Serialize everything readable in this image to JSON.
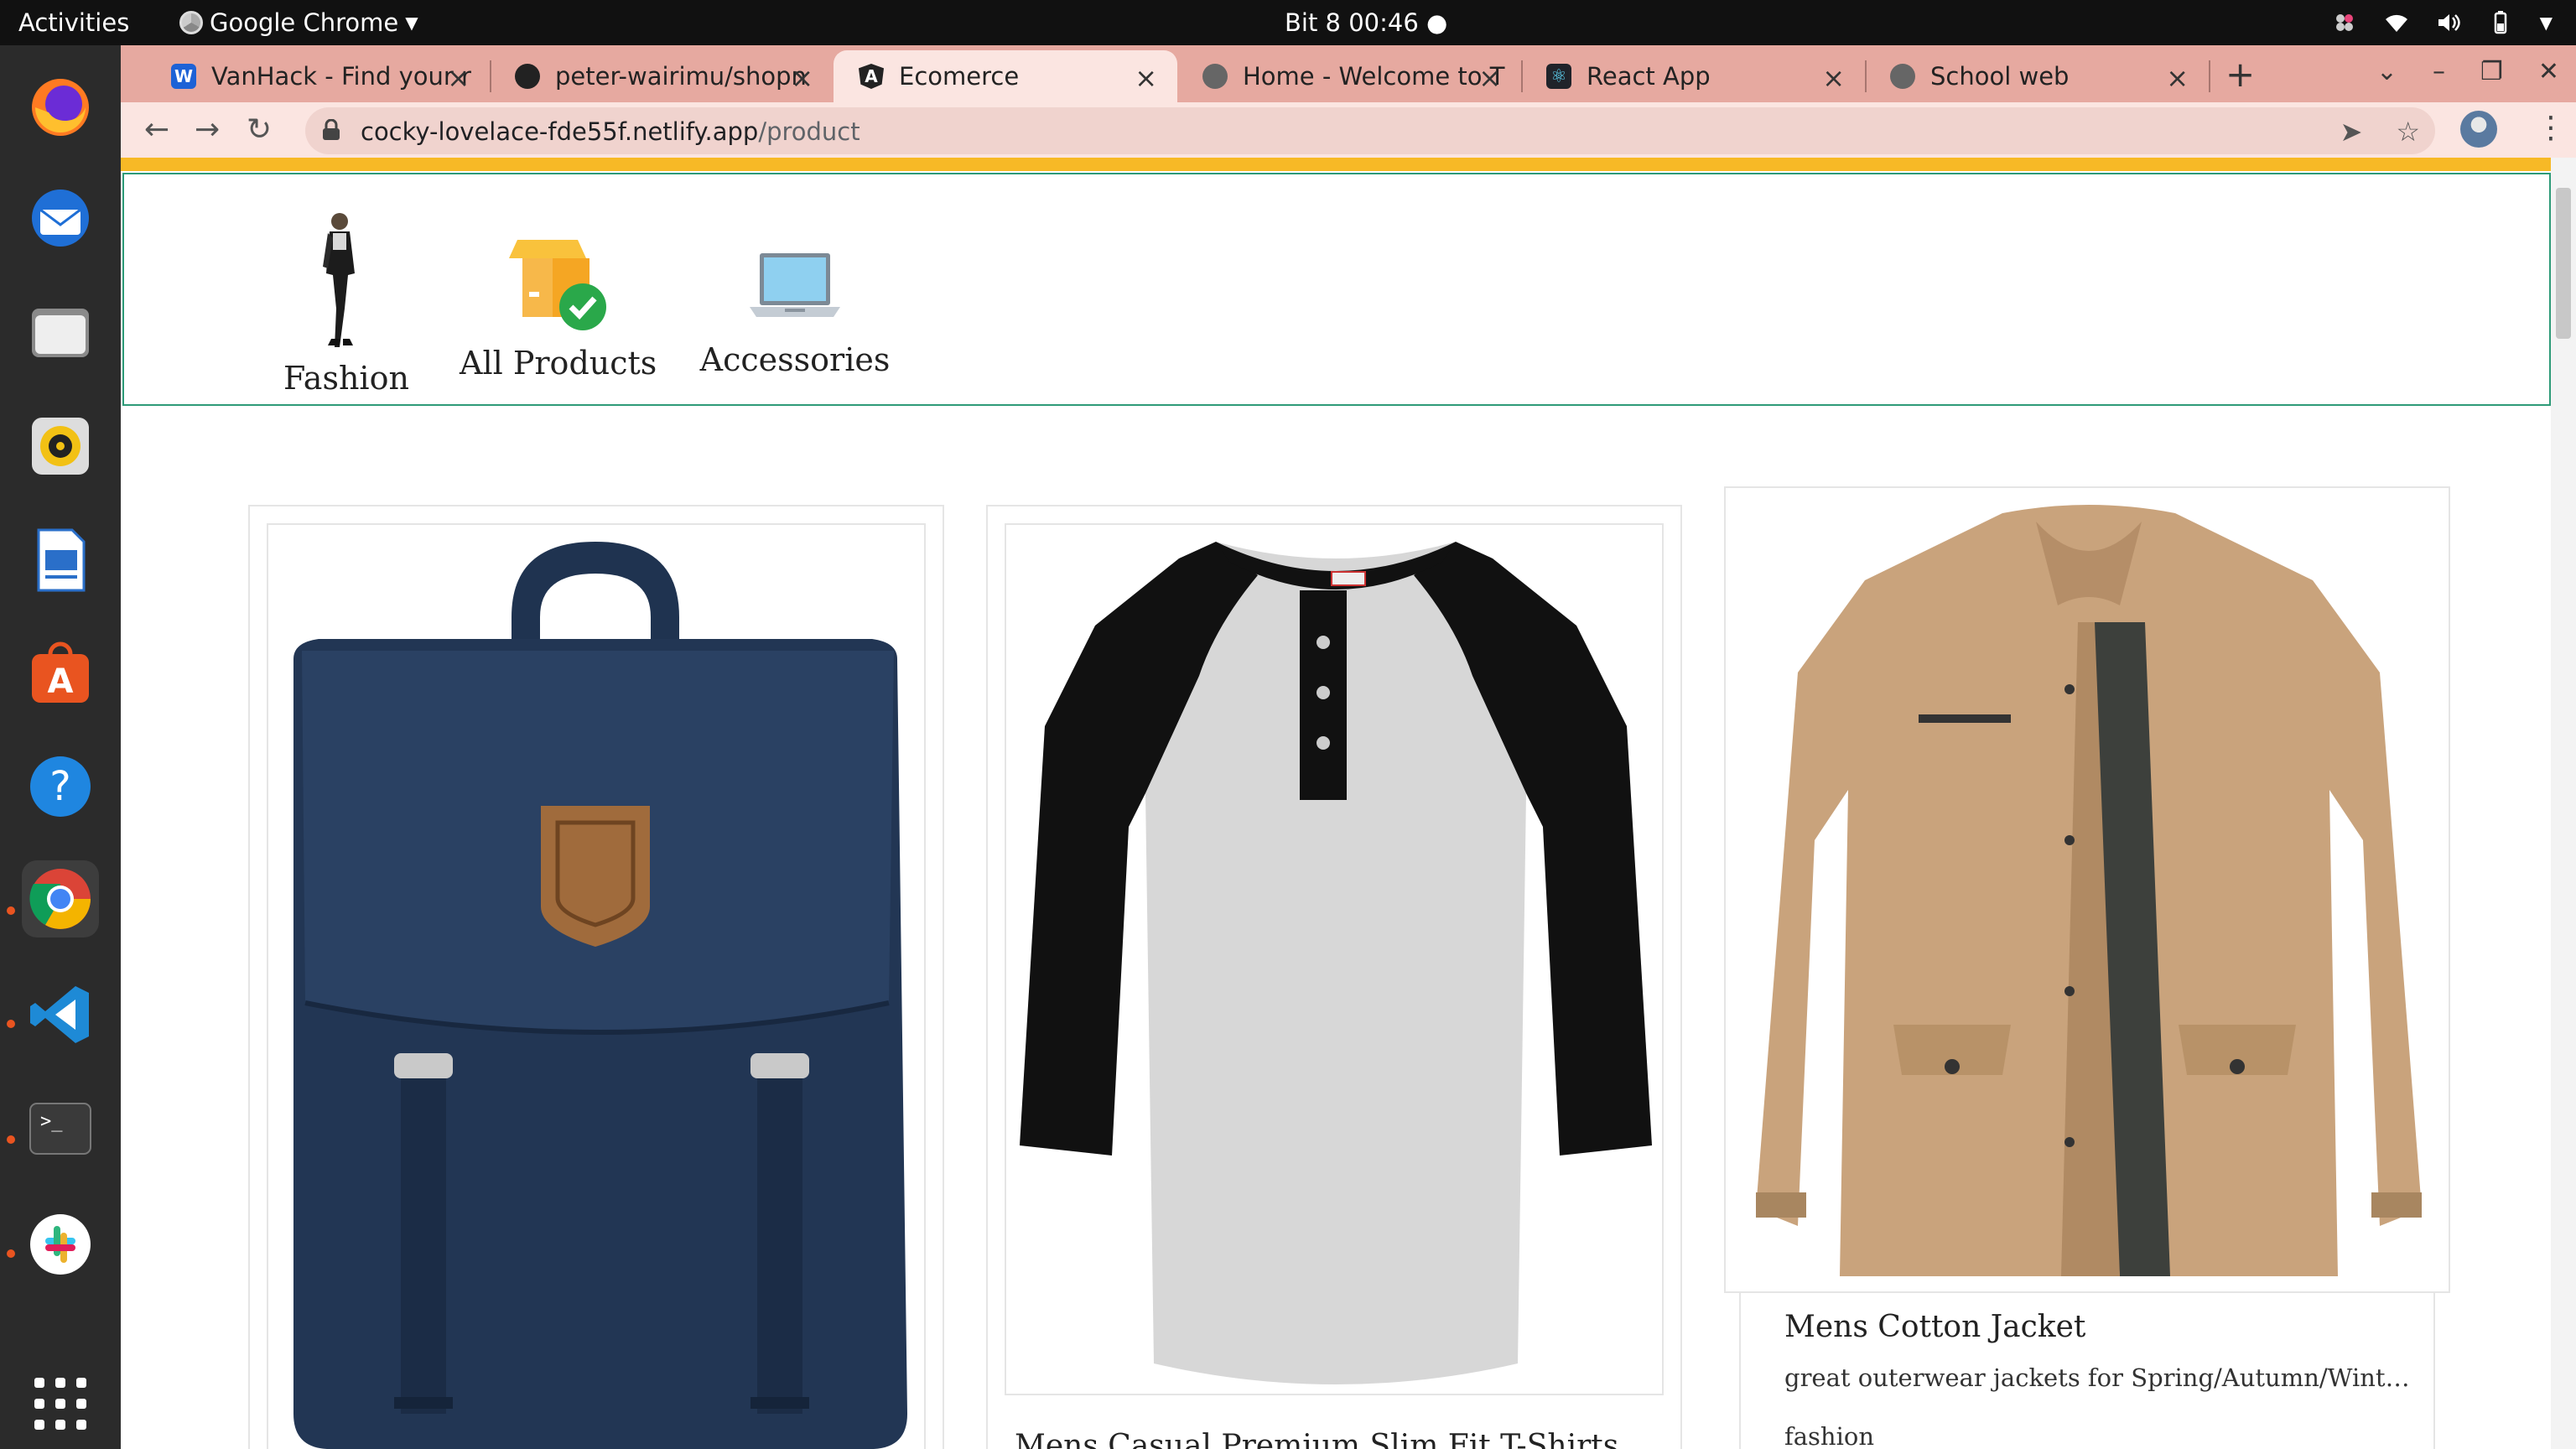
{
  "desktop": {
    "activities": "Activities",
    "app_menu": "Google Chrome",
    "clock": "Bit 8  00:46"
  },
  "browser": {
    "tabs": [
      {
        "title": "VanHack - Find your r",
        "icon": "vanhack-icon"
      },
      {
        "title": "peter-wairimu/shopn",
        "icon": "github-icon"
      },
      {
        "title": "Ecomerce",
        "icon": "angular-icon",
        "active": true
      },
      {
        "title": "Home - Welcome to T",
        "icon": "globe-icon"
      },
      {
        "title": "React App",
        "icon": "react-icon"
      },
      {
        "title": "School web",
        "icon": "globe-icon"
      }
    ],
    "url_host": "cocky-lovelace-fde55f.netlify.app",
    "url_path": "/product"
  },
  "colors": {
    "accent_bar": "#f7b926",
    "nav_border": "#2e9b78",
    "tabstrip": "#e6a9a0"
  },
  "categories": [
    {
      "label": "Fashion",
      "icon": "fashion-model-icon"
    },
    {
      "label": "All Products",
      "icon": "boxes-check-icon"
    },
    {
      "label": "Accessories",
      "icon": "laptop-icon"
    }
  ],
  "products": [
    {
      "title": "",
      "image": "navy-backpack",
      "description": "",
      "category": ""
    },
    {
      "title": "Mens Casual Premium Slim Fit T-Shirts",
      "image": "raglan-tshirt",
      "description": "",
      "category": ""
    },
    {
      "title": "Mens Cotton Jacket",
      "image": "tan-cotton-jacket",
      "description": "great outerwear jackets for Spring/Autumn/Winter, su…",
      "category": "fashion"
    }
  ]
}
